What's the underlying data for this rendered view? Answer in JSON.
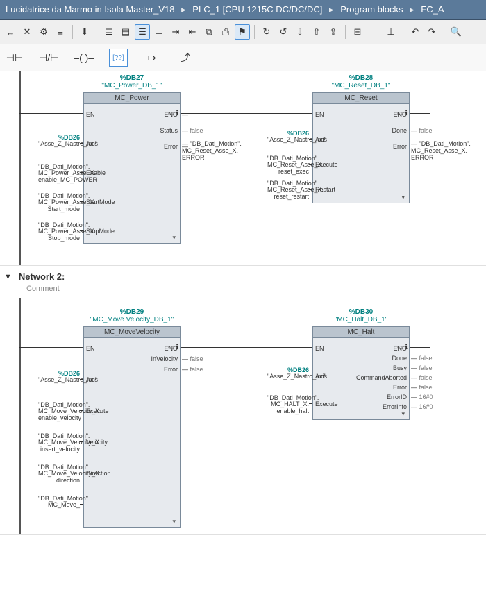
{
  "breadcrumb": {
    "items": [
      "Lucidatrice da Marmo in Isola Master_V18",
      "PLC_1 [CPU 1215C DC/DC/DC]",
      "Program blocks",
      "FC_A"
    ]
  },
  "toolbar1": {
    "buttons": [
      "insert-network",
      "delete-network",
      "goto",
      "structure",
      "",
      "download",
      "",
      "list-view",
      "block-view",
      "display-mode",
      "text-box",
      "goto-def",
      "goto-ref",
      "open-db",
      "favorites",
      "filter",
      "",
      "monitor",
      "go-online",
      "go-offline",
      "compile",
      "download-hw",
      "",
      "expand",
      "collapse",
      "align",
      "",
      "undo",
      "redo",
      "",
      "search"
    ],
    "glyphs": [
      "↔",
      "✕",
      "⚙",
      "≡",
      "",
      "⬇",
      "",
      "≣",
      "▤",
      "☰",
      "▭",
      "⇥",
      "⇤",
      "⧉",
      "⎙",
      "⚑",
      "",
      "↻",
      "↺",
      "⇩",
      "⇧",
      "⇪",
      "",
      "⊟",
      "│",
      "⊥",
      "",
      "↶",
      "↷",
      "",
      "🔍"
    ]
  },
  "toolbar2": {
    "buttons": [
      "nc-contact",
      "no-contact",
      "coil",
      "empty-box",
      "branch",
      "jump"
    ],
    "glyphs": [
      "⊣⊢",
      "⊣/⊢",
      "–( )–",
      "[??]",
      "↦",
      "⤴"
    ]
  },
  "network1": {
    "blockA": {
      "db": "%DB27",
      "dbname": "\"MC_Power_DB_1\"",
      "title": "MC_Power",
      "pins_left": [
        {
          "lbl": "EN",
          "src": ""
        },
        {
          "lbl": "Axis",
          "src": "\"Asse_Z_Nastro_luc\"",
          "teal": "%DB26"
        },
        {
          "lbl": "Enable",
          "src": "\"DB_Dati_Motion\".MC_Power_Asse_X.enable_MC_POWER"
        },
        {
          "lbl": "StartMode",
          "src": "\"DB_Dati_Motion\".MC_Power_Asse_X.Start_mode"
        },
        {
          "lbl": "StopMode",
          "src": "\"DB_Dati_Motion\".MC_Power_Asse_X.Stop_mode"
        }
      ],
      "pins_right": [
        {
          "lbl": "ENO",
          "val": ""
        },
        {
          "lbl": "Status",
          "val": "false"
        },
        {
          "lbl": "Error",
          "val": "",
          "to": "\"DB_Dati_Motion\".MC_Reset_Asse_X.ERROR"
        }
      ]
    },
    "blockB": {
      "db": "%DB28",
      "dbname": "\"MC_Reset_DB_1\"",
      "title": "MC_Reset",
      "pins_left": [
        {
          "lbl": "EN"
        },
        {
          "lbl": "Axis",
          "src": "\"Asse_Z_Nastro_luc\"",
          "teal": "%DB26"
        },
        {
          "lbl": "Execute",
          "src": "\"DB_Dati_Motion\".MC_Reset_Asse_X.reset_exec"
        },
        {
          "lbl": "Restart",
          "src": "\"DB_Dati_Motion\".MC_Reset_Asse_X.reset_restart"
        }
      ],
      "pins_right": [
        {
          "lbl": "ENO"
        },
        {
          "lbl": "Done",
          "val": "false"
        },
        {
          "lbl": "Error",
          "to": "\"DB_Dati_Motion\".MC_Reset_Asse_X.ERROR"
        }
      ]
    }
  },
  "network2": {
    "title": "Network 2:",
    "comment": "Comment",
    "blockA": {
      "db": "%DB29",
      "dbname": "\"MC_Move Velocity_DB_1\"",
      "title": "MC_MoveVelocity",
      "pins_left": [
        {
          "lbl": "EN"
        },
        {
          "lbl": "Axis",
          "src": "\"Asse_Z_Nastro_luc\"",
          "teal": "%DB26"
        },
        {
          "lbl": "Execute",
          "src": "\"DB_Dati_Motion\".MC_Move_Velocity_X.enable_velocity"
        },
        {
          "lbl": "Velocity",
          "src": "\"DB_Dati_Motion\".MC_Move_Velocity_X.insert_velocity"
        },
        {
          "lbl": "Direction",
          "src": "\"DB_Dati_Motion\".MC_Move_Velocity_X.direction"
        },
        {
          "lbl": "",
          "src": "\"DB_Dati_Motion\".MC_Move_"
        }
      ],
      "pins_right": [
        {
          "lbl": "ENO"
        },
        {
          "lbl": "InVelocity",
          "val": "false"
        },
        {
          "lbl": "Error",
          "val": "false"
        }
      ]
    },
    "blockB": {
      "db": "%DB30",
      "dbname": "\"MC_Halt_DB_1\"",
      "title": "MC_Halt",
      "pins_left": [
        {
          "lbl": "EN"
        },
        {
          "lbl": "Axis",
          "src": "\"Asse_Z_Nastro_luc\"",
          "teal": "%DB26"
        },
        {
          "lbl": "Execute",
          "src": "\"DB_Dati_Motion\".MC_HALT_X.enable_halt"
        }
      ],
      "pins_right": [
        {
          "lbl": "ENO"
        },
        {
          "lbl": "Done",
          "val": "false"
        },
        {
          "lbl": "Busy",
          "val": "false"
        },
        {
          "lbl": "CommandAborted",
          "val": "false"
        },
        {
          "lbl": "Error",
          "val": "false"
        },
        {
          "lbl": "ErrorID",
          "val": "16#0"
        },
        {
          "lbl": "ErrorInfo",
          "val": "16#0"
        }
      ]
    }
  }
}
